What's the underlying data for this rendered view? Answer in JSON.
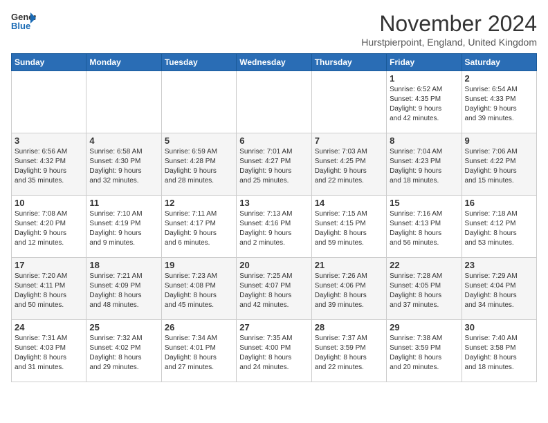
{
  "header": {
    "logo": {
      "general": "General",
      "blue": "Blue"
    },
    "title": "November 2024",
    "location": "Hurstpierpoint, England, United Kingdom"
  },
  "weekdays": [
    "Sunday",
    "Monday",
    "Tuesday",
    "Wednesday",
    "Thursday",
    "Friday",
    "Saturday"
  ],
  "weeks": [
    [
      {
        "day": "",
        "info": ""
      },
      {
        "day": "",
        "info": ""
      },
      {
        "day": "",
        "info": ""
      },
      {
        "day": "",
        "info": ""
      },
      {
        "day": "",
        "info": ""
      },
      {
        "day": "1",
        "info": "Sunrise: 6:52 AM\nSunset: 4:35 PM\nDaylight: 9 hours\nand 42 minutes."
      },
      {
        "day": "2",
        "info": "Sunrise: 6:54 AM\nSunset: 4:33 PM\nDaylight: 9 hours\nand 39 minutes."
      }
    ],
    [
      {
        "day": "3",
        "info": "Sunrise: 6:56 AM\nSunset: 4:32 PM\nDaylight: 9 hours\nand 35 minutes."
      },
      {
        "day": "4",
        "info": "Sunrise: 6:58 AM\nSunset: 4:30 PM\nDaylight: 9 hours\nand 32 minutes."
      },
      {
        "day": "5",
        "info": "Sunrise: 6:59 AM\nSunset: 4:28 PM\nDaylight: 9 hours\nand 28 minutes."
      },
      {
        "day": "6",
        "info": "Sunrise: 7:01 AM\nSunset: 4:27 PM\nDaylight: 9 hours\nand 25 minutes."
      },
      {
        "day": "7",
        "info": "Sunrise: 7:03 AM\nSunset: 4:25 PM\nDaylight: 9 hours\nand 22 minutes."
      },
      {
        "day": "8",
        "info": "Sunrise: 7:04 AM\nSunset: 4:23 PM\nDaylight: 9 hours\nand 18 minutes."
      },
      {
        "day": "9",
        "info": "Sunrise: 7:06 AM\nSunset: 4:22 PM\nDaylight: 9 hours\nand 15 minutes."
      }
    ],
    [
      {
        "day": "10",
        "info": "Sunrise: 7:08 AM\nSunset: 4:20 PM\nDaylight: 9 hours\nand 12 minutes."
      },
      {
        "day": "11",
        "info": "Sunrise: 7:10 AM\nSunset: 4:19 PM\nDaylight: 9 hours\nand 9 minutes."
      },
      {
        "day": "12",
        "info": "Sunrise: 7:11 AM\nSunset: 4:17 PM\nDaylight: 9 hours\nand 6 minutes."
      },
      {
        "day": "13",
        "info": "Sunrise: 7:13 AM\nSunset: 4:16 PM\nDaylight: 9 hours\nand 2 minutes."
      },
      {
        "day": "14",
        "info": "Sunrise: 7:15 AM\nSunset: 4:15 PM\nDaylight: 8 hours\nand 59 minutes."
      },
      {
        "day": "15",
        "info": "Sunrise: 7:16 AM\nSunset: 4:13 PM\nDaylight: 8 hours\nand 56 minutes."
      },
      {
        "day": "16",
        "info": "Sunrise: 7:18 AM\nSunset: 4:12 PM\nDaylight: 8 hours\nand 53 minutes."
      }
    ],
    [
      {
        "day": "17",
        "info": "Sunrise: 7:20 AM\nSunset: 4:11 PM\nDaylight: 8 hours\nand 50 minutes."
      },
      {
        "day": "18",
        "info": "Sunrise: 7:21 AM\nSunset: 4:09 PM\nDaylight: 8 hours\nand 48 minutes."
      },
      {
        "day": "19",
        "info": "Sunrise: 7:23 AM\nSunset: 4:08 PM\nDaylight: 8 hours\nand 45 minutes."
      },
      {
        "day": "20",
        "info": "Sunrise: 7:25 AM\nSunset: 4:07 PM\nDaylight: 8 hours\nand 42 minutes."
      },
      {
        "day": "21",
        "info": "Sunrise: 7:26 AM\nSunset: 4:06 PM\nDaylight: 8 hours\nand 39 minutes."
      },
      {
        "day": "22",
        "info": "Sunrise: 7:28 AM\nSunset: 4:05 PM\nDaylight: 8 hours\nand 37 minutes."
      },
      {
        "day": "23",
        "info": "Sunrise: 7:29 AM\nSunset: 4:04 PM\nDaylight: 8 hours\nand 34 minutes."
      }
    ],
    [
      {
        "day": "24",
        "info": "Sunrise: 7:31 AM\nSunset: 4:03 PM\nDaylight: 8 hours\nand 31 minutes."
      },
      {
        "day": "25",
        "info": "Sunrise: 7:32 AM\nSunset: 4:02 PM\nDaylight: 8 hours\nand 29 minutes."
      },
      {
        "day": "26",
        "info": "Sunrise: 7:34 AM\nSunset: 4:01 PM\nDaylight: 8 hours\nand 27 minutes."
      },
      {
        "day": "27",
        "info": "Sunrise: 7:35 AM\nSunset: 4:00 PM\nDaylight: 8 hours\nand 24 minutes."
      },
      {
        "day": "28",
        "info": "Sunrise: 7:37 AM\nSunset: 3:59 PM\nDaylight: 8 hours\nand 22 minutes."
      },
      {
        "day": "29",
        "info": "Sunrise: 7:38 AM\nSunset: 3:59 PM\nDaylight: 8 hours\nand 20 minutes."
      },
      {
        "day": "30",
        "info": "Sunrise: 7:40 AM\nSunset: 3:58 PM\nDaylight: 8 hours\nand 18 minutes."
      }
    ]
  ]
}
